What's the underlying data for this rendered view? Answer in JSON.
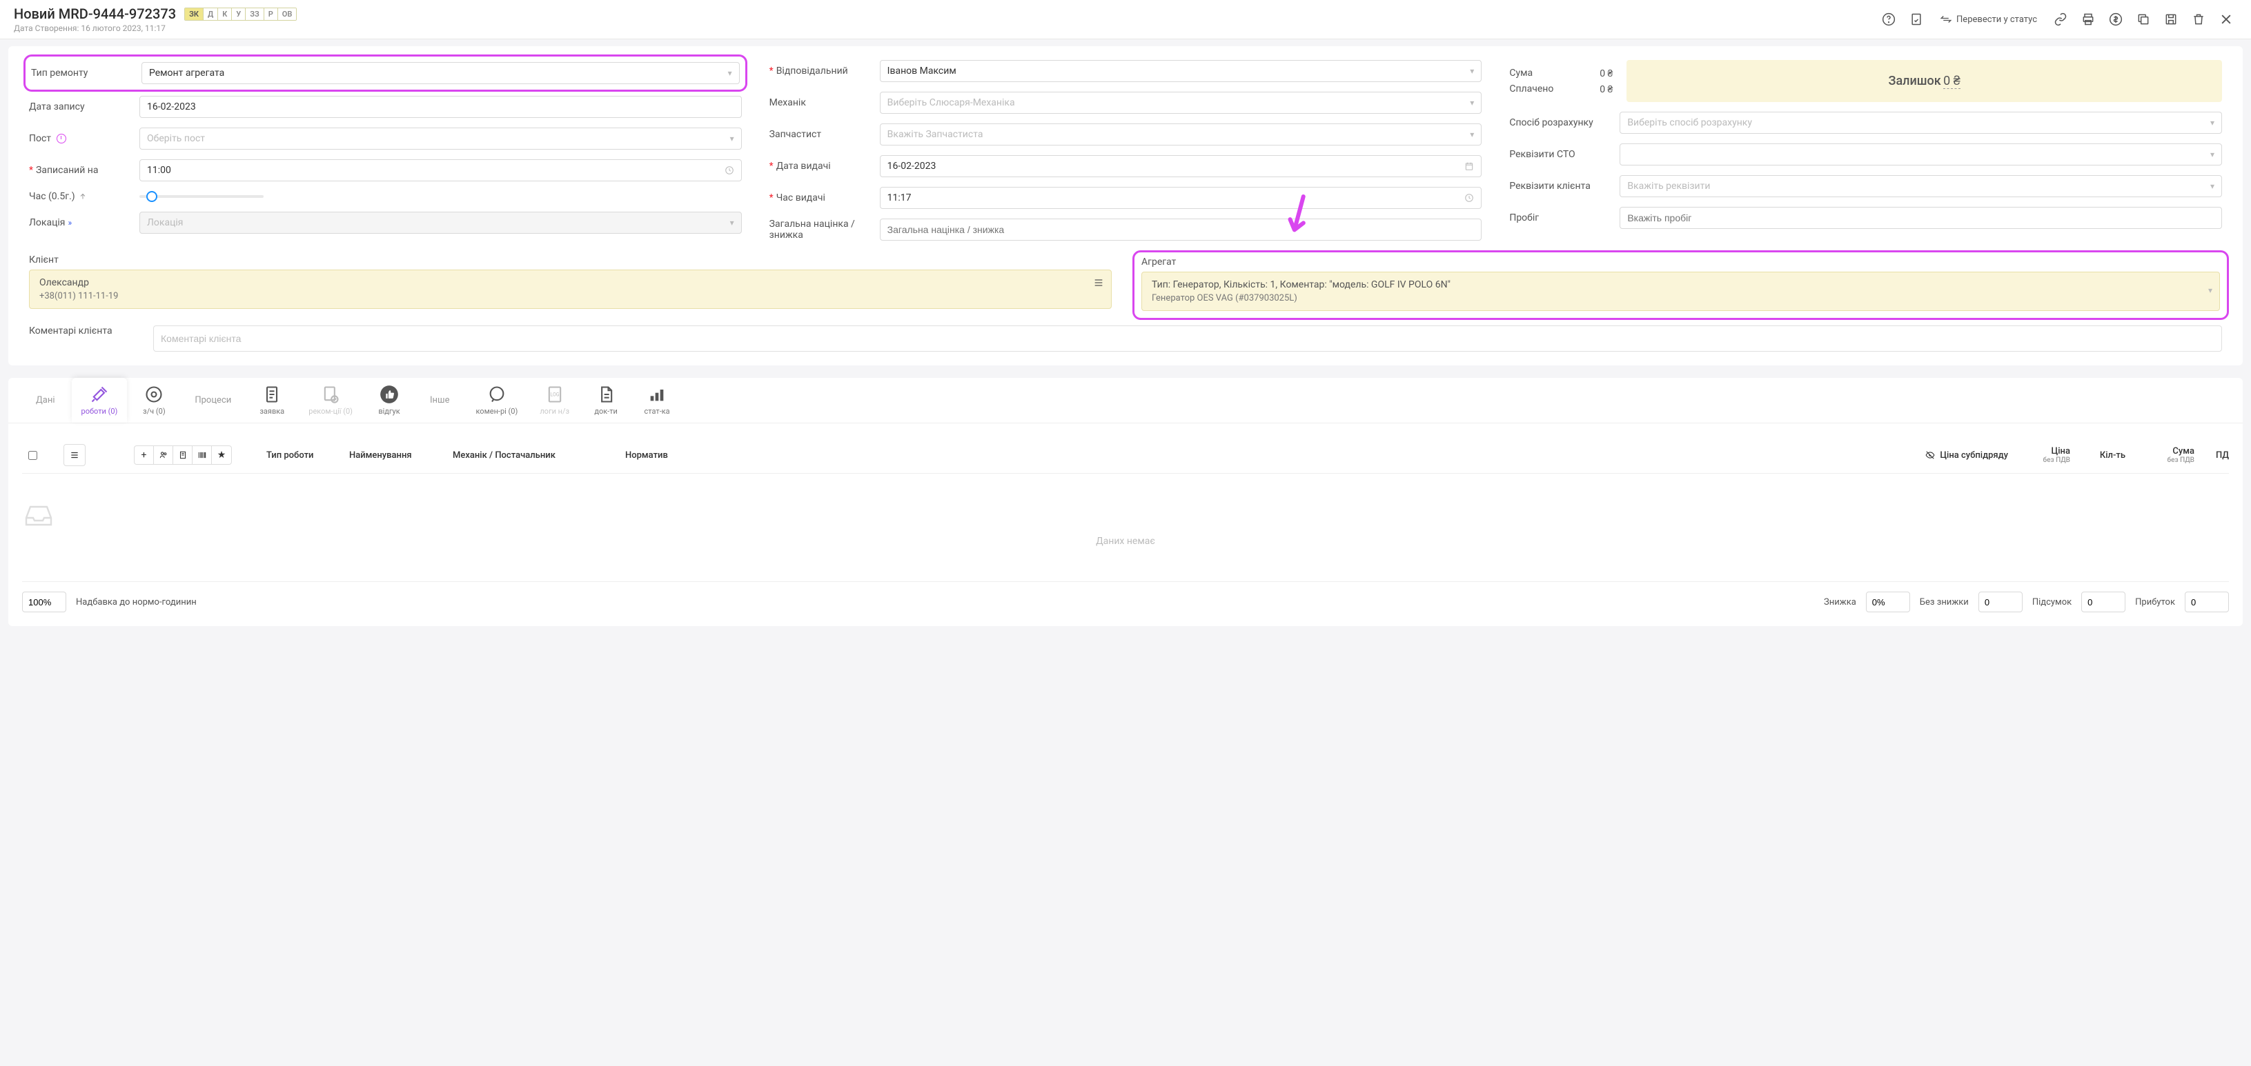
{
  "header": {
    "title": "Новий MRD-9444-972373",
    "subtitle": "Дата Створення: 16 лютого 2023, 11:17",
    "badges": [
      "ЗК",
      "Д",
      "К",
      "У",
      "ЗЗ",
      "Р",
      "ОВ"
    ],
    "active_badge": 0,
    "status_action": "Перевести у статус"
  },
  "form": {
    "col1": {
      "repair_type_label": "Тип ремонту",
      "repair_type_value": "Ремонт агрегата",
      "record_date_label": "Дата запису",
      "record_date_value": "16-02-2023",
      "post_label": "Пост",
      "post_placeholder": "Оберіть пост",
      "scheduled_label": "Записаний на",
      "scheduled_value": "11:00",
      "time_label": "Час (0.5г.)",
      "location_label": "Локація",
      "location_placeholder": "Локація"
    },
    "col2": {
      "responsible_label": "Відповідальний",
      "responsible_value": "Іванов Максим",
      "mechanic_label": "Механік",
      "mechanic_placeholder": "Виберіть Слюсаря-Механіка",
      "partsman_label": "Запчастист",
      "partsman_placeholder": "Вкажіть Запчастиста",
      "issue_date_label": "Дата видачі",
      "issue_date_value": "16-02-2023",
      "issue_time_label": "Час видачі",
      "issue_time_value": "11:17",
      "markup_label": "Загальна націнка / знижка",
      "markup_placeholder": "Загальна націнка / знижка"
    },
    "col3": {
      "sum_label": "Сума",
      "sum_value": "0 ₴",
      "paid_label": "Сплачено",
      "paid_value": "0 ₴",
      "balance_label": "Залишок",
      "balance_value": "0 ₴",
      "payment_method_label": "Спосіб розрахунку",
      "payment_method_placeholder": "Виберіть спосіб розрахунку",
      "sto_req_label": "Реквізити СТО",
      "client_req_label": "Реквізити клієнта",
      "client_req_placeholder": "Вкажіть реквізити",
      "mileage_label": "Пробіг",
      "mileage_placeholder": "Вкажіть пробіг"
    }
  },
  "client": {
    "label": "Клієнт",
    "name": "Олександр",
    "phone": "+38(011) 111-11-19"
  },
  "aggregate": {
    "label": "Агрегат",
    "line1": "Тип: Генератор,  Кількість: 1,  Коментар: \"модель: GOLF IV POLO 6N\"",
    "line2": "Генератор OES VAG (#037903025L)"
  },
  "comments": {
    "label": "Коментарі клієнта",
    "placeholder": "Коментарі клієнта"
  },
  "tabs": {
    "group1": "Дані",
    "works": "роботи (0)",
    "parts": "з/ч (0)",
    "group2": "Процеси",
    "request": "заявка",
    "recom": "реком-ції (0)",
    "review": "відгук",
    "group3": "Інше",
    "comments": "комен-рі (0)",
    "logs": "логи н/з",
    "docs": "док-ти",
    "stats": "стат-ка"
  },
  "table": {
    "cols": {
      "work_type": "Тип роботи",
      "name": "Найменування",
      "mechanic": "Механік / Постачальник",
      "norm": "Норматив",
      "subcontract": "Ціна субпідряду",
      "price": "Ціна",
      "price_sub": "без ПДВ",
      "qty": "Кіл-ть",
      "sum": "Сума",
      "sum_sub": "без ПДВ",
      "pd": "ПД"
    },
    "empty": "Даних немає"
  },
  "footer": {
    "percent": "100%",
    "norm_markup": "Надбавка до нормо-годинин",
    "discount_label": "Знижка",
    "discount_value": "0%",
    "no_discount_label": "Без знижки",
    "no_discount_value": "0",
    "subtotal_label": "Підсумок",
    "subtotal_value": "0",
    "profit_label": "Прибуток",
    "profit_value": "0"
  }
}
